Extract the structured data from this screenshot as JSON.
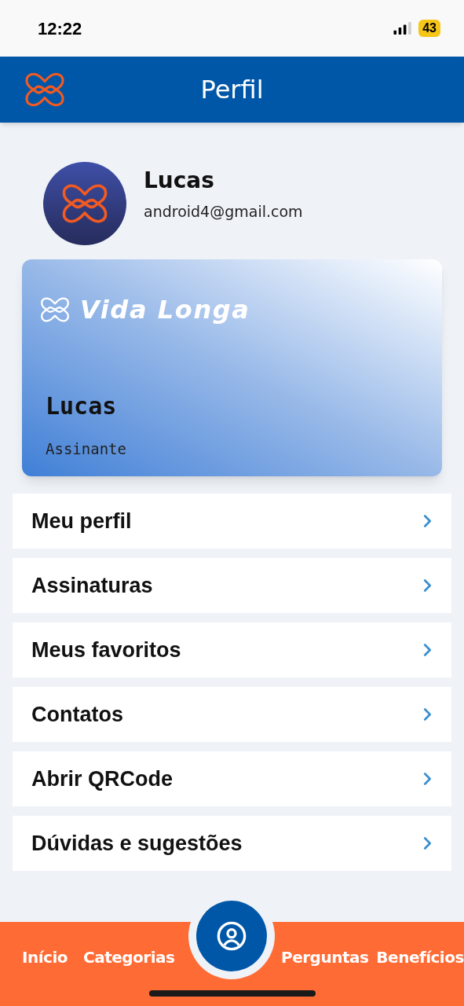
{
  "status_bar": {
    "time": "12:22",
    "battery": "43"
  },
  "header": {
    "title": "Perfil"
  },
  "profile": {
    "name": "Lucas",
    "email": "android4@gmail.com"
  },
  "card": {
    "brand": "Vida Longa",
    "name": "Lucas",
    "plan": "Assinante"
  },
  "menu": [
    {
      "label": "Meu perfil"
    },
    {
      "label": "Assinaturas"
    },
    {
      "label": "Meus favoritos"
    },
    {
      "label": "Contatos"
    },
    {
      "label": "Abrir QRCode"
    },
    {
      "label": "Dúvidas e sugestões"
    }
  ],
  "bottom_nav": {
    "left": [
      "Início",
      "Categorias"
    ],
    "right": [
      "Perguntas",
      "Benefícios"
    ]
  }
}
